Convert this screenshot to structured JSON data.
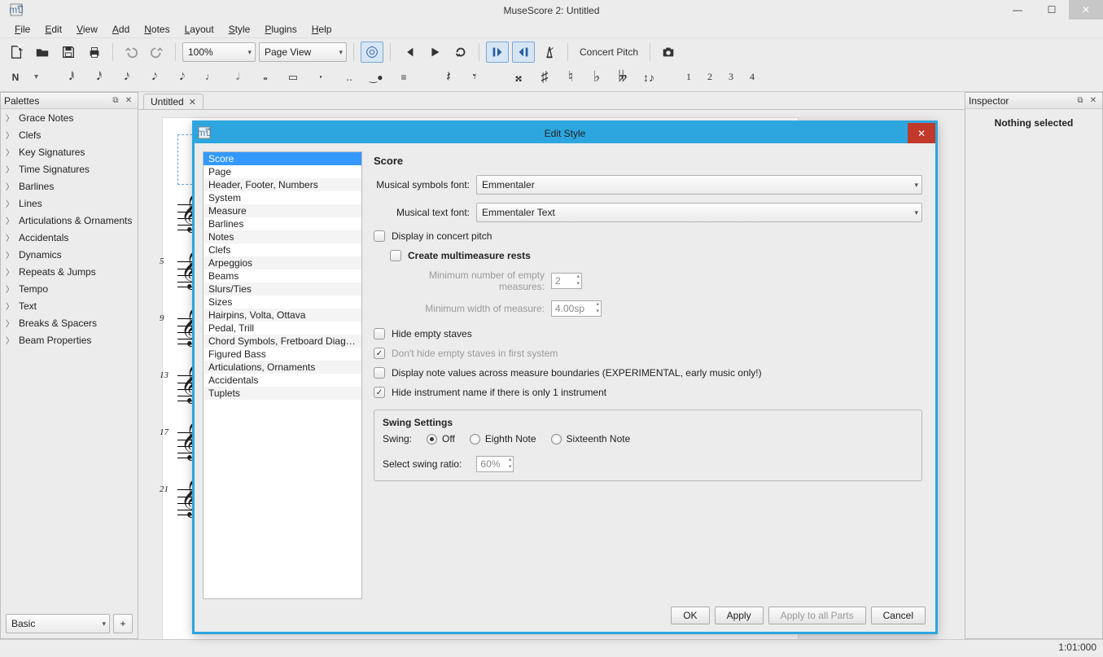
{
  "window": {
    "title": "MuseScore 2: Untitled"
  },
  "menubar": [
    "File",
    "Edit",
    "View",
    "Add",
    "Notes",
    "Layout",
    "Style",
    "Plugins",
    "Help"
  ],
  "toolbar1": {
    "zoom": "100%",
    "viewmode": "Page View",
    "concert_pitch": "Concert Pitch"
  },
  "toolbar2": {
    "voices": [
      "1",
      "2",
      "3",
      "4"
    ]
  },
  "palettes": {
    "title": "Palettes",
    "items": [
      "Grace Notes",
      "Clefs",
      "Key Signatures",
      "Time Signatures",
      "Barlines",
      "Lines",
      "Articulations & Ornaments",
      "Accidentals",
      "Dynamics",
      "Repeats & Jumps",
      "Tempo",
      "Text",
      "Breaks & Spacers",
      "Beam Properties"
    ],
    "footer_combo": "Basic"
  },
  "tab": {
    "label": "Untitled"
  },
  "score": {
    "measure_numbers": [
      "5",
      "9",
      "13",
      "17",
      "21"
    ]
  },
  "inspector": {
    "title": "Inspector",
    "body": "Nothing selected"
  },
  "statusbar": {
    "time": "1:01:000"
  },
  "dialog": {
    "title": "Edit Style",
    "categories": [
      "Score",
      "Page",
      "Header, Footer, Numbers",
      "System",
      "Measure",
      "Barlines",
      "Notes",
      "Clefs",
      "Arpeggios",
      "Beams",
      "Slurs/Ties",
      "Sizes",
      "Hairpins, Volta, Ottava",
      "Pedal, Trill",
      "Chord Symbols, Fretboard Diagra…",
      "Figured Bass",
      "Articulations, Ornaments",
      "Accidentals",
      "Tuplets"
    ],
    "selected_category": "Score",
    "panel_heading": "Score",
    "symbols_font_label": "Musical symbols font:",
    "symbols_font": "Emmentaler",
    "text_font_label": "Musical text font:",
    "text_font": "Emmentaler Text",
    "concert_pitch_cb": "Display in concert pitch",
    "multimeasure_label": "Create multimeasure rests",
    "min_empty_label": "Minimum number of empty measures:",
    "min_empty_value": "2",
    "min_width_label": "Minimum width of measure:",
    "min_width_value": "4.00sp",
    "hide_empty": "Hide empty staves",
    "dont_hide_first": "Don't hide empty staves in first system",
    "display_note_values": "Display note values across measure boundaries (EXPERIMENTAL, early music only!)",
    "hide_instr": "Hide instrument name if there is only 1 instrument",
    "swing_title": "Swing Settings",
    "swing_label": "Swing:",
    "swing_off": "Off",
    "swing_eighth": "Eighth Note",
    "swing_sixteenth": "Sixteenth Note",
    "swing_ratio_label": "Select swing ratio:",
    "swing_ratio_value": "60%",
    "buttons": {
      "ok": "OK",
      "apply": "Apply",
      "apply_all": "Apply to all Parts",
      "cancel": "Cancel"
    }
  }
}
